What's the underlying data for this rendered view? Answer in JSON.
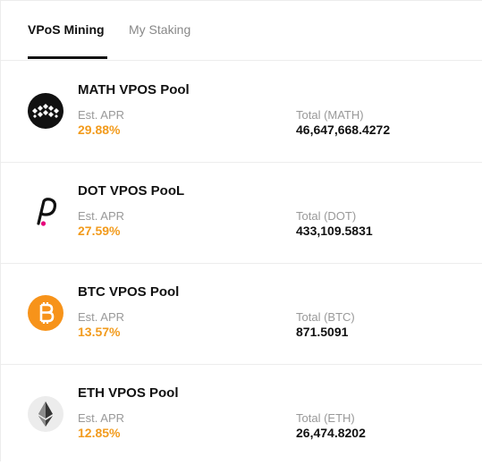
{
  "tabs": {
    "active_label": "VPoS Mining",
    "inactive_label": "My Staking"
  },
  "colors": {
    "apr": "#f29b1d",
    "btc": "#f7931a",
    "math_bg": "#111111",
    "dot_pink": "#e6007a"
  },
  "pools": [
    {
      "name": "MATH VPOS Pool",
      "apr_label": "Est. APR",
      "apr_value": "29.88%",
      "total_label": "Total (MATH)",
      "total_value": "46,647,668.4272",
      "icon": "math-icon"
    },
    {
      "name": "DOT VPOS PooL",
      "apr_label": "Est. APR",
      "apr_value": "27.59%",
      "total_label": "Total (DOT)",
      "total_value": "433,109.5831",
      "icon": "polkadot-icon"
    },
    {
      "name": "BTC VPOS Pool",
      "apr_label": "Est. APR",
      "apr_value": "13.57%",
      "total_label": "Total (BTC)",
      "total_value": "871.5091",
      "icon": "bitcoin-icon"
    },
    {
      "name": "ETH VPOS Pool",
      "apr_label": "Est. APR",
      "apr_value": "12.85%",
      "total_label": "Total (ETH)",
      "total_value": "26,474.8202",
      "icon": "ethereum-icon"
    }
  ]
}
